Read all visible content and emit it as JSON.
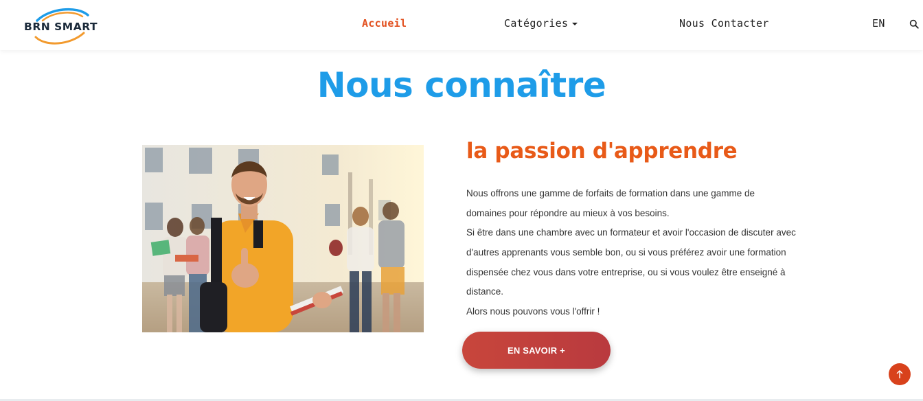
{
  "brand": {
    "name": "BRN SMART",
    "arc_colors": [
      "#1e9ce8",
      "#f29a2e"
    ]
  },
  "nav": {
    "home": "Accueil",
    "categories": "Catégories",
    "contact": "Nous Contacter",
    "language": "EN",
    "search_icon": "search-icon",
    "active_color": "#e2501f"
  },
  "hero": {
    "title": "Nous connaître",
    "title_color": "#1e9ce8"
  },
  "about": {
    "title": "la passion d'apprendre",
    "title_color": "#e85a18",
    "paragraph_1": "Nous offrons une gamme de forfaits de formation dans une gamme de domaines pour répondre au mieux à vos besoins.",
    "paragraph_2": "Si être dans une chambre avec un formateur et avoir l'occasion de discuter avec d'autres apprenants vous semble bon, ou si vous préférez avoir une formation dispensée chez vous dans votre entreprise, ou si vous voulez être enseigné à distance.",
    "paragraph_3": "Alors nous pouvons vous l'offrir !",
    "cta_label": "EN SAVOIR +",
    "cta_color": "#c8463c"
  },
  "scroll_top": {
    "icon": "arrow-up-icon",
    "color": "#d8421c"
  }
}
